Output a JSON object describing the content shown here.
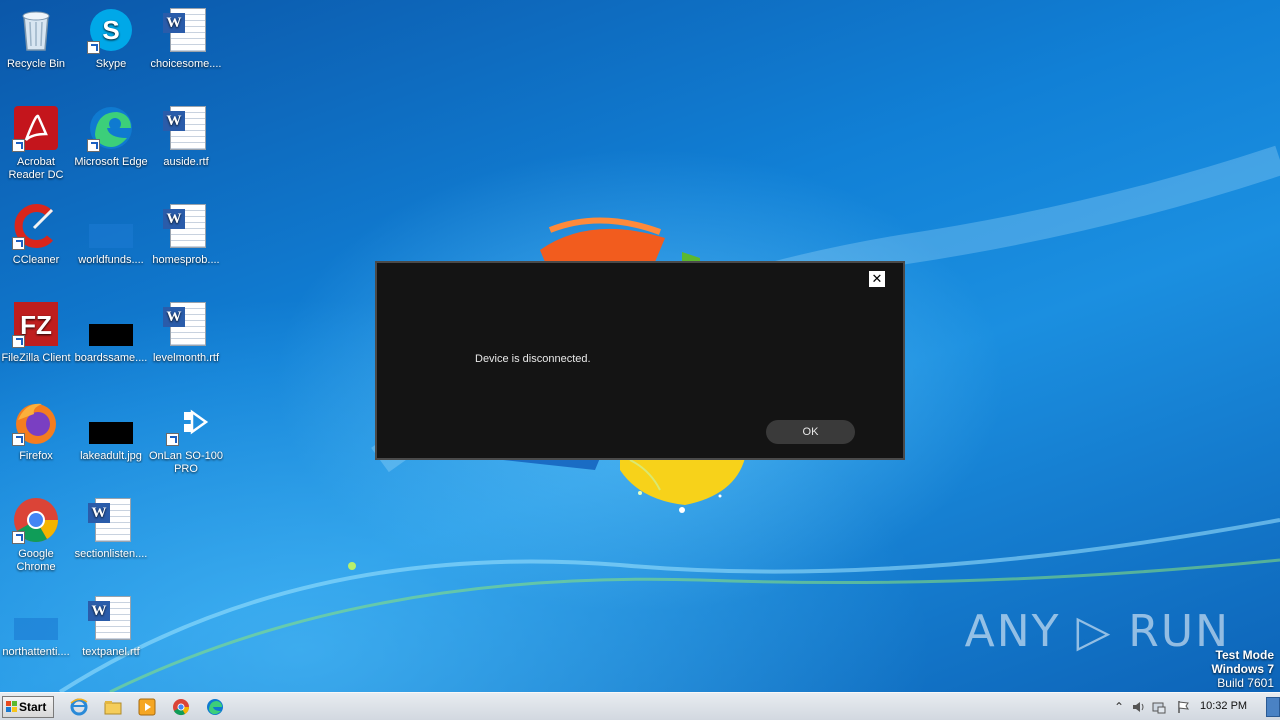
{
  "desktop": {
    "icons": [
      {
        "label": "Recycle Bin",
        "kind": "recycle-bin-icon"
      },
      {
        "label": "Skype",
        "kind": "skype-icon"
      },
      {
        "label": "choicesome....",
        "kind": "word-document-icon"
      },
      {
        "label": "Acrobat Reader DC",
        "kind": "acrobat-icon"
      },
      {
        "label": "Microsoft Edge",
        "kind": "edge-icon"
      },
      {
        "label": "auside.rtf",
        "kind": "word-document-icon"
      },
      {
        "label": "CCleaner",
        "kind": "ccleaner-icon"
      },
      {
        "label": "worldfunds....",
        "kind": "folder-icon"
      },
      {
        "label": "homesprob....",
        "kind": "word-document-icon"
      },
      {
        "label": "FileZilla Client",
        "kind": "filezilla-icon"
      },
      {
        "label": "boardssame....",
        "kind": "image-file-icon"
      },
      {
        "label": "levelmonth.rtf",
        "kind": "word-document-icon"
      },
      {
        "label": "Firefox",
        "kind": "firefox-icon"
      },
      {
        "label": "lakeadult.jpg",
        "kind": "image-file-icon"
      },
      {
        "label": "OnLan SO-100 PRO",
        "kind": "onlan-icon"
      },
      {
        "label": "Google Chrome",
        "kind": "chrome-icon"
      },
      {
        "label": "sectionlisten....",
        "kind": "word-document-icon"
      },
      {
        "label": "northattenti....",
        "kind": "folder-icon"
      },
      {
        "label": "textpanel.rtf",
        "kind": "word-document-icon"
      }
    ]
  },
  "dialog": {
    "close_glyph": "✕",
    "message": "Device is disconnected.",
    "ok_label": "OK"
  },
  "watermark": {
    "text": "ANY ▷ RUN"
  },
  "test_mode": {
    "line1": "Test Mode",
    "line2": "Windows 7",
    "line3": "Build 7601"
  },
  "taskbar": {
    "start_label": "Start",
    "pinned": [
      "internet-explorer-icon",
      "file-explorer-icon",
      "media-player-icon",
      "chrome-icon",
      "edge-icon"
    ],
    "tray": {
      "expand_glyph": "⌃",
      "clock": "10:32 PM"
    }
  },
  "colors": {
    "dialog_bg": "#141414",
    "ok_button_bg": "#3a3a3a",
    "taskbar_bg": "#dde2e8"
  }
}
